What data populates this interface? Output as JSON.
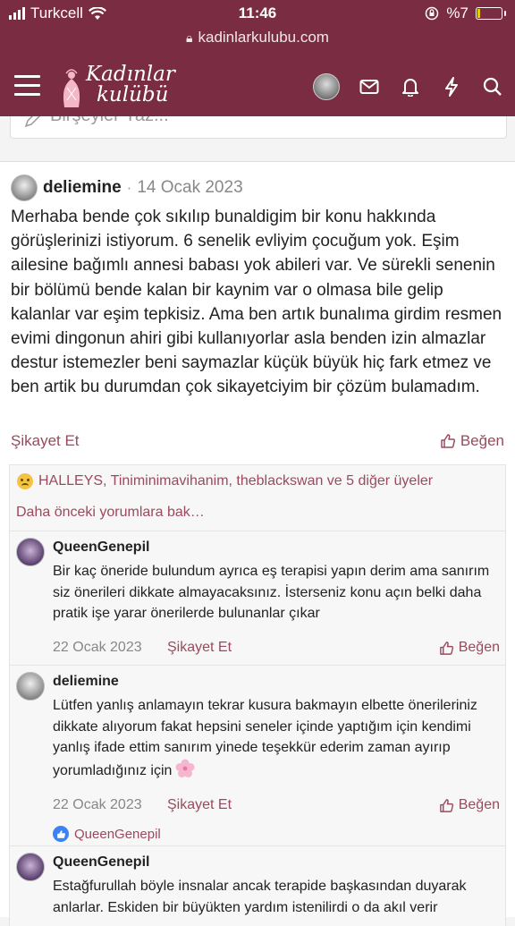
{
  "status": {
    "carrier": "Turkcell",
    "time": "11:46",
    "battery": "%7",
    "url": "kadinlarkulubu.com"
  },
  "header": {
    "logo_line1": "Kadınlar",
    "logo_line2": "kulübü"
  },
  "composer": {
    "placeholder": "Birşeyler Yaz..."
  },
  "post": {
    "author": "deliemine",
    "separator": "·",
    "date": "14 Ocak 2023",
    "body": "Merhaba bende çok sıkılıp bunaldigim bir konu hakkında görüşlerinizi istiyorum. 6 senelik evliyim çocuğum yok. Eşim ailesine bağımlı annesi babası yok abileri var. Ve sürekli senenin bir bölümü bende kalan bir kaynim var o olmasa bile gelip kalanlar var eşim tepkisiz. Ama ben artık bunalıma girdim resmen evimi dingonun ahiri gibi kullanıyorlar asla benden izin almazlar destur istemezler beni saymazlar küçük büyük hiç fark etmez ve ben artik bu durumdan çok sikayetciyim bir çözüm bulamadım.",
    "report_label": "Şikayet Et",
    "like_label": "Beğen",
    "reactions_text": "HALLEYS, Tiniminimavihanim, theblackswan ve 5 diğer üyeler"
  },
  "comments": {
    "older_label": "Daha önceki yorumlara bak…",
    "items": [
      {
        "author": "QueenGenepil",
        "body": "Bir kaç öneride bulundum ayrıca eş terapisi yapın derim ama sanırım siz önerileri dikkate almayacaksınız. İsterseniz konu açın belki daha pratik işe yarar önerilerde bulunanlar çıkar",
        "date": "22 Ocak 2023",
        "report_label": "Şikayet Et",
        "like_label": "Beğen"
      },
      {
        "author": "deliemine",
        "body": "Lütfen yanlış anlamayın tekrar kusura bakmayın elbette önerileriniz dikkate alıyorum fakat hepsini seneler içinde yaptığım için kendimi yanlış ifade ettim sanırım yinede teşekkür ederim zaman ayırıp yorumladığınız için",
        "date": "22 Ocak 2023",
        "report_label": "Şikayet Et",
        "like_label": "Beğen",
        "reaction_user": "QueenGenepil"
      },
      {
        "author": "QueenGenepil",
        "body": "Estağfurullah böyle insnalar ancak terapide başkasından duyarak anlarlar. Eskiden bir büyükten yardım istenilirdi o da akıl verir"
      }
    ]
  },
  "colors": {
    "brand": "#7a2d42",
    "link": "#9a4a5e"
  }
}
